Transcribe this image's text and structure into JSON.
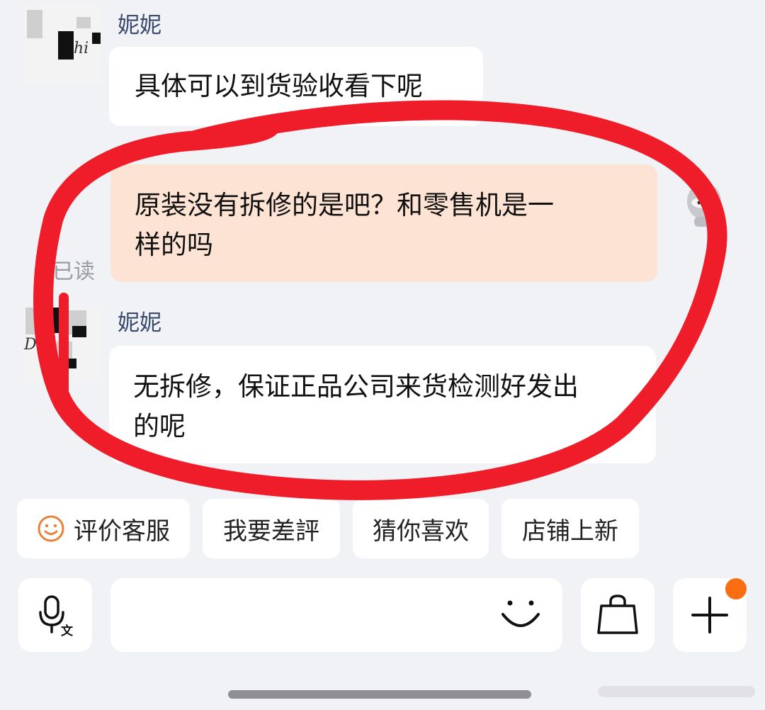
{
  "messages": [
    {
      "sender": "妮妮",
      "text": "具体可以到货验收看下呢",
      "direction": "incoming"
    },
    {
      "text_line1": "原装没有拆修的是吧？和零售机是一",
      "text_line2": "样的吗",
      "direction": "outgoing",
      "status": "已读"
    },
    {
      "sender": "妮妮",
      "text_line1": "无拆修，保证正品公司来货检测好发出",
      "text_line2": "的呢",
      "direction": "incoming"
    }
  ],
  "quick_replies": [
    {
      "label": "评价客服",
      "icon": "smiley-icon"
    },
    {
      "label": "我要差評"
    },
    {
      "label": "猜你喜欢"
    },
    {
      "label": "店铺上新"
    }
  ],
  "input_bar": {
    "icons": [
      "voice-translate-icon",
      "emoji-icon",
      "shopping-bag-icon",
      "plus-icon"
    ],
    "voice_sub_glyph": "文"
  },
  "colors": {
    "background": "#f1f2f6",
    "incoming_bubble": "#ffffff",
    "outgoing_bubble": "#fde3d3",
    "sender_name": "#3a4a6b",
    "annotation_circle": "#ef1d29",
    "notification_badge": "#fa6d12",
    "smiley_icon": "#e8823a"
  }
}
